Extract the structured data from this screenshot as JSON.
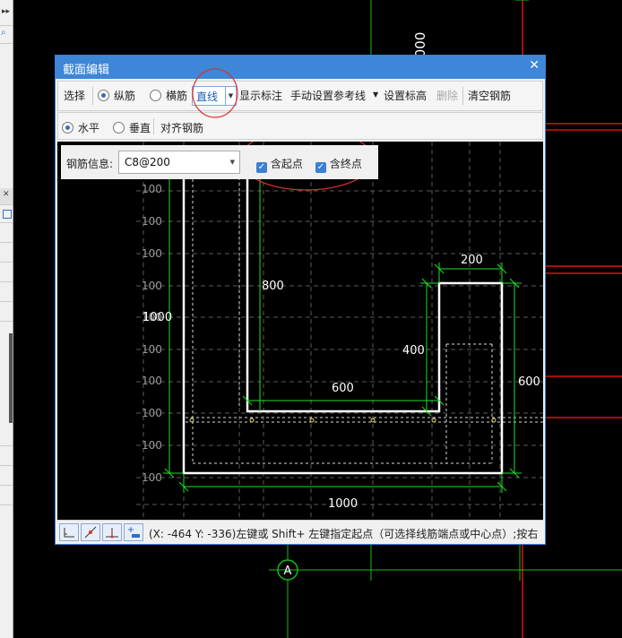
{
  "background": {
    "axis_dimension_label": "000",
    "axis_marker_label": "A"
  },
  "dialog": {
    "title": "截面编辑",
    "close_glyph": "✕"
  },
  "toolbar1": {
    "select_label": "选择",
    "longitudinal_label": "纵筋",
    "transverse_label": "横筋",
    "line_mode_value": "直线",
    "show_annotation_label": "显示标注",
    "manual_refline_label": "手动设置参考线",
    "set_elevation_label": "设置标高",
    "delete_label": "删除",
    "clear_rebar_label": "清空钢筋"
  },
  "toolbar2": {
    "horizontal_label": "水平",
    "vertical_label": "垂直",
    "align_rebar_label": "对齐钢筋"
  },
  "rebar_info": {
    "label": "钢筋信息:",
    "value": "C8@200",
    "start_point_label": "含起点",
    "start_point_checked": true,
    "end_point_label": "含终点",
    "end_point_checked": true
  },
  "drawing": {
    "grid_row_label": "100",
    "dims": {
      "left_height": "1000",
      "inner_height": "800",
      "top_width": "200",
      "notch_depth": "400",
      "inner_width": "600",
      "right_height": "600",
      "bottom_width": "1000"
    }
  },
  "statusbar": {
    "message": "(X: -464 Y: -336)左键或 Shift+ 左键指定起点（可选择线筋端点或中心点）;按右"
  },
  "colors": {
    "title_blue": "#3e86d8",
    "cad_red": "#e01010",
    "cad_green": "#10c010",
    "dim_green": "#20e020",
    "annotation_circle": "#e03030"
  }
}
